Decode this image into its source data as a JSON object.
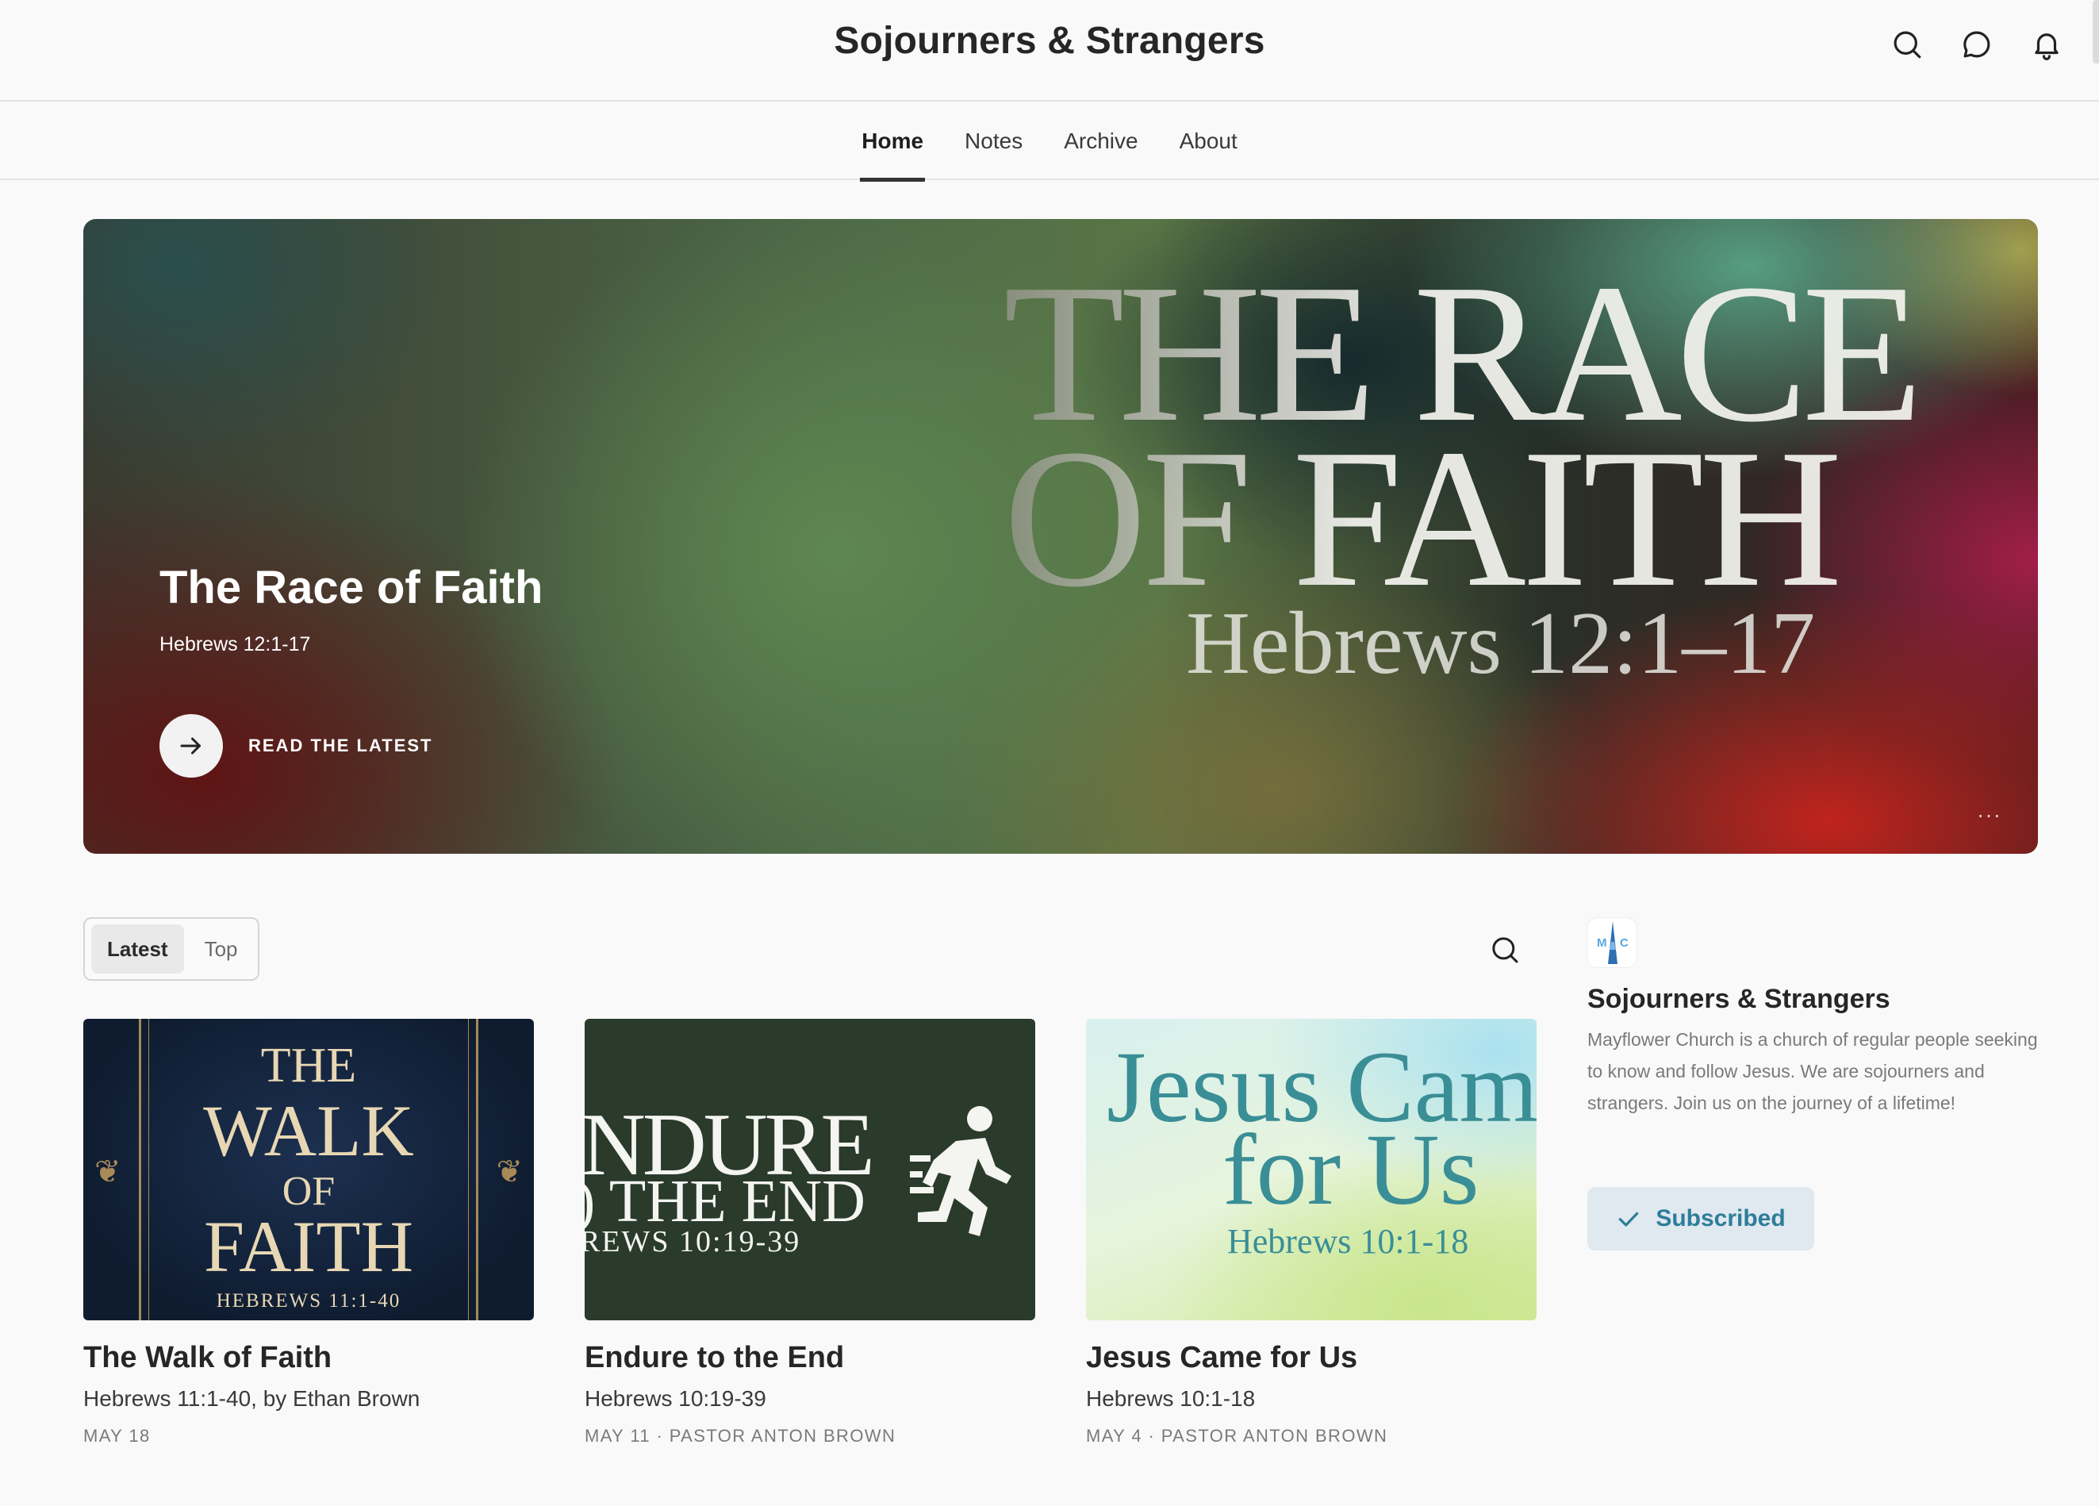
{
  "header": {
    "site_title": "Sojourners & Strangers",
    "icons": [
      "search-icon",
      "chat-icon",
      "bell-icon"
    ]
  },
  "nav": {
    "tabs": [
      {
        "label": "Home",
        "active": true
      },
      {
        "label": "Notes",
        "active": false
      },
      {
        "label": "Archive",
        "active": false
      },
      {
        "label": "About",
        "active": false
      }
    ]
  },
  "hero": {
    "art_line1": "THE RACE",
    "art_line2": "OF FAITH",
    "art_line3": "Hebrews 12:1–17",
    "title": "The Race of Faith",
    "subtitle": "Hebrews 12:1-17",
    "cta_label": "READ THE LATEST",
    "more_label": "···"
  },
  "feed": {
    "sort_options": [
      "Latest",
      "Top"
    ],
    "active_sort": "Latest"
  },
  "posts": [
    {
      "title": "The Walk of Faith",
      "subtitle": "Hebrews 11:1-40, by Ethan Brown",
      "meta": "MAY 18",
      "art": {
        "l1": "THE",
        "l2": "WALK",
        "l3": "OF",
        "l4": "FAITH",
        "l5": "HEBREWS 11:1-40"
      }
    },
    {
      "title": "Endure to the End",
      "subtitle": "Hebrews 10:19-39",
      "meta": "MAY 11 · PASTOR ANTON BROWN",
      "art": {
        "l1": "NDURE",
        "l2": ") THE END",
        "l3": "REWS 10:19-39"
      }
    },
    {
      "title": "Jesus Came for Us",
      "subtitle": "Hebrews 10:1-18",
      "meta": "MAY 4 · PASTOR ANTON BROWN",
      "art": {
        "l1": "Jesus Came",
        "l2": "for Us",
        "l3": "Hebrews 10:1-18"
      }
    }
  ],
  "sidebar": {
    "logo_letters": {
      "left": "M",
      "right": "C"
    },
    "name": "Sojourners & Strangers",
    "description": "Mayflower Church is a church of regular people seeking to know and follow Jesus. We are sojourners and strangers. Join us on the journey of a lifetime!",
    "subscribe_label": "Subscribed"
  },
  "colors": {
    "accent": "#2e7d9a",
    "subscribe_bg": "#dfe9ef",
    "text": "#262626"
  }
}
